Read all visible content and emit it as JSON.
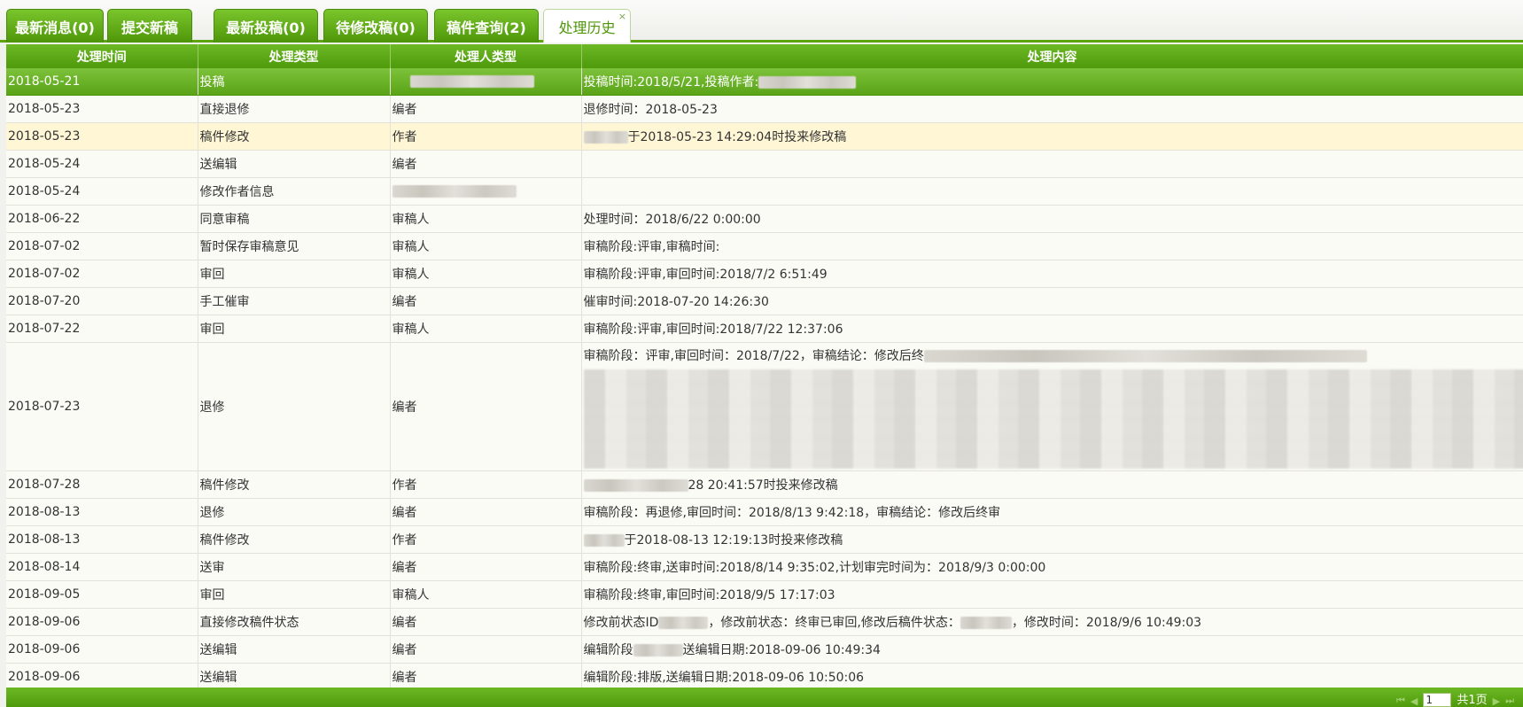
{
  "tabs": [
    {
      "label": "最新消息(0)"
    },
    {
      "label": "提交新稿"
    },
    {
      "label": "最新投稿(0)"
    },
    {
      "label": "待修改稿(0)"
    },
    {
      "label": "稿件查询(2)"
    },
    {
      "label": "处理历史"
    }
  ],
  "tab_close": "×",
  "table": {
    "headers": [
      "处理时间",
      "处理类型",
      "处理人类型",
      "处理内容"
    ],
    "rows": [
      [
        "2018-05-21",
        "投稿",
        "",
        "投稿时间:2018/5/21,投稿作者:"
      ],
      [
        "2018-05-23",
        "直接退修",
        "编者",
        "退修时间：2018-05-23"
      ],
      [
        "2018-05-23",
        "稿件修改",
        "作者",
        "于2018-05-23 14:29:04时投来修改稿"
      ],
      [
        "2018-05-24",
        "送编辑",
        "编者",
        ""
      ],
      [
        "2018-05-24",
        "修改作者信息",
        "",
        ""
      ],
      [
        "2018-06-22",
        "同意审稿",
        "审稿人",
        "处理时间：2018/6/22 0:00:00"
      ],
      [
        "2018-07-02",
        "暂时保存审稿意见",
        "审稿人",
        "审稿阶段:评审,审稿时间:"
      ],
      [
        "2018-07-02",
        "审回",
        "审稿人",
        "审稿阶段:评审,审回时间:2018/7/2 6:51:49"
      ],
      [
        "2018-07-20",
        "手工催审",
        "编者",
        "催审时间:2018-07-20 14:26:30"
      ],
      [
        "2018-07-22",
        "审回",
        "审稿人",
        "审稿阶段:评审,审回时间:2018/7/22 12:37:06"
      ],
      [
        "2018-07-23",
        "退修",
        "编者",
        "审稿阶段：评审,审回时间：2018/7/22，审稿结论：修改后终"
      ],
      [
        "2018-07-28",
        "稿件修改",
        "作者",
        "28 20:41:57时投来修改稿"
      ],
      [
        "2018-08-13",
        "退修",
        "编者",
        "审稿阶段：再退修,审回时间：2018/8/13 9:42:18，审稿结论：修改后终审"
      ],
      [
        "2018-08-13",
        "稿件修改",
        "作者",
        "于2018-08-13 12:19:13时投来修改稿"
      ],
      [
        "2018-08-14",
        "送审",
        "编者",
        "审稿阶段:终审,送审时间:2018/8/14 9:35:02,计划审完时间为：2018/9/3 0:00:00"
      ],
      [
        "2018-09-05",
        "审回",
        "审稿人",
        "审稿阶段:终审,审回时间:2018/9/5 17:17:03"
      ],
      [
        "2018-09-06",
        "直接修改稿件状态",
        "编者",
        "修改前状态ID"
      ],
      [
        "2018-09-06",
        "送编辑",
        "编者",
        "编辑阶段"
      ],
      [
        "2018-09-06",
        "送编辑",
        "编者",
        "编辑阶段:排版,送编辑日期:2018-09-06 10:50:06"
      ]
    ],
    "row_17_extra": [
      "，修改前状态：终审已审回,修改后稿件状态：",
      "，修改时间：2018/9/6 10:49:03"
    ],
    "row_18_extra": "送编辑日期:2018-09-06 10:49:34"
  },
  "pager": {
    "page_value": "1",
    "total_label": "共1页"
  },
  "colors": {
    "accent": "#5da40f",
    "selected_row": "#6db42a",
    "hover_row": "#fff6d5"
  }
}
